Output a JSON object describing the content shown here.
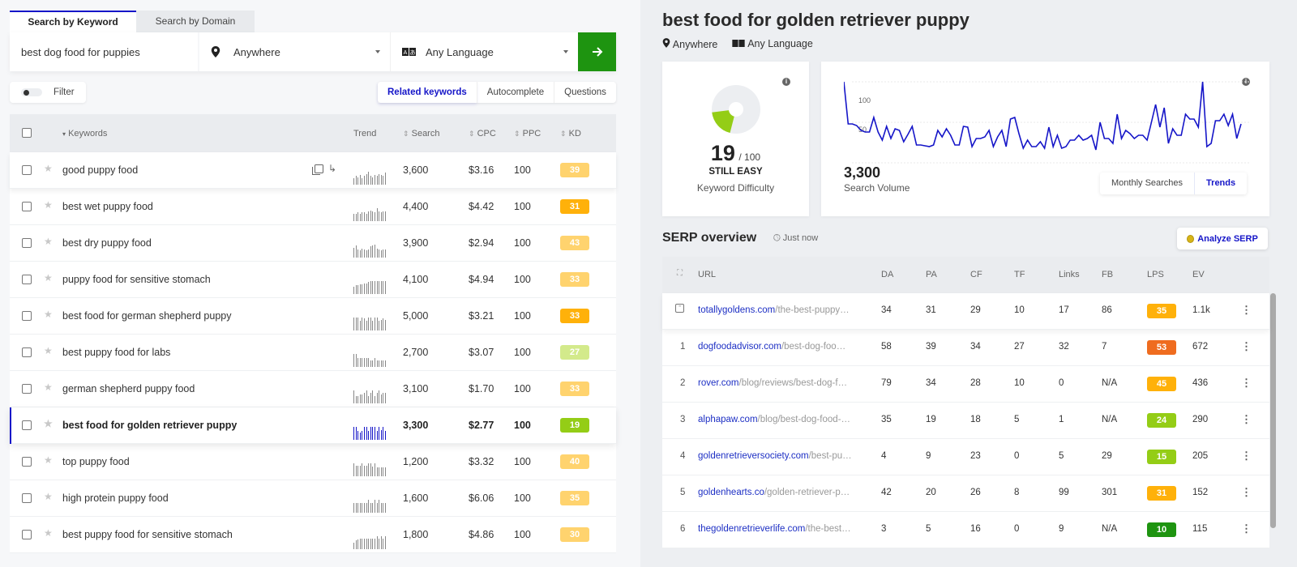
{
  "tabs": [
    {
      "label": "Search by Keyword",
      "active": true
    },
    {
      "label": "Search by Domain",
      "active": false
    }
  ],
  "search": {
    "query": "best dog food for puppies",
    "location": "Anywhere",
    "language": "Any Language",
    "go_icon": "arrow-right-icon"
  },
  "filter": {
    "label": "Filter",
    "enabled": false
  },
  "keyword_modes": [
    {
      "label": "Related keywords",
      "active": true
    },
    {
      "label": "Autocomplete",
      "active": false
    },
    {
      "label": "Questions",
      "active": false
    }
  ],
  "keyword_table": {
    "columns": {
      "keywords": "Keywords",
      "trend": "Trend",
      "search": "Search",
      "cpc": "CPC",
      "ppc": "PPC",
      "kd": "KD"
    },
    "rows": [
      {
        "keyword": "good puppy food",
        "search": "3,600",
        "cpc": "$3.16",
        "ppc": "100",
        "kd": "39",
        "kd_color": "#ffd36e",
        "trend": [
          6,
          8,
          7,
          9,
          6,
          8,
          10,
          12,
          8,
          7,
          9,
          8,
          10,
          9,
          8,
          11
        ],
        "hover": true
      },
      {
        "keyword": "best wet puppy food",
        "search": "4,400",
        "cpc": "$4.42",
        "ppc": "100",
        "kd": "31",
        "kd_color": "#ffb10a",
        "trend": [
          7,
          7,
          8,
          7,
          8,
          8,
          7,
          9,
          10,
          9,
          8,
          12,
          9,
          8,
          9,
          9
        ]
      },
      {
        "keyword": "best dry puppy food",
        "search": "3,900",
        "cpc": "$2.94",
        "ppc": "100",
        "kd": "43",
        "kd_color": "#ffd36e",
        "trend": [
          10,
          12,
          8,
          7,
          9,
          8,
          7,
          8,
          11,
          12,
          13,
          9,
          8,
          7,
          8,
          8
        ]
      },
      {
        "keyword": "puppy food for sensitive stomach",
        "search": "4,100",
        "cpc": "$4.94",
        "ppc": "100",
        "kd": "33",
        "kd_color": "#ffd36e",
        "trend": [
          7,
          8,
          8,
          9,
          9,
          10,
          10,
          11,
          12,
          12,
          12,
          12,
          12,
          12,
          12,
          12
        ]
      },
      {
        "keyword": "best food for german shepherd puppy",
        "search": "5,000",
        "cpc": "$3.21",
        "ppc": "100",
        "kd": "33",
        "kd_color": "#ffb10a",
        "trend": [
          12,
          12,
          12,
          9,
          12,
          11,
          9,
          12,
          12,
          9,
          12,
          12,
          9,
          10,
          11,
          10
        ]
      },
      {
        "keyword": "best puppy food for labs",
        "search": "2,700",
        "cpc": "$3.07",
        "ppc": "100",
        "kd": "27",
        "kd_color": "#d3ea8b",
        "trend": [
          12,
          12,
          8,
          8,
          8,
          8,
          8,
          8,
          6,
          6,
          8,
          6,
          6,
          6,
          6,
          6
        ]
      },
      {
        "keyword": "german shepherd puppy food",
        "search": "3,100",
        "cpc": "$1.70",
        "ppc": "100",
        "kd": "33",
        "kd_color": "#ffd36e",
        "trend": [
          12,
          7,
          7,
          8,
          8,
          10,
          12,
          7,
          10,
          12,
          7,
          10,
          12,
          8,
          10,
          10
        ]
      },
      {
        "keyword": "best food for golden retriever puppy",
        "search": "3,300",
        "cpc": "$2.77",
        "ppc": "100",
        "kd": "19",
        "kd_color": "#94cd16",
        "trend": [
          12,
          12,
          8,
          7,
          8,
          12,
          12,
          8,
          12,
          12,
          12,
          8,
          12,
          9,
          12,
          8
        ],
        "selected": true
      },
      {
        "keyword": "top puppy food",
        "search": "1,200",
        "cpc": "$3.32",
        "ppc": "100",
        "kd": "40",
        "kd_color": "#ffd36e",
        "trend": [
          12,
          10,
          10,
          10,
          12,
          10,
          10,
          12,
          12,
          9,
          12,
          8,
          8,
          8,
          8,
          8
        ]
      },
      {
        "keyword": "high protein puppy food",
        "search": "1,600",
        "cpc": "$6.06",
        "ppc": "100",
        "kd": "35",
        "kd_color": "#ffd36e",
        "trend": [
          9,
          9,
          9,
          9,
          9,
          9,
          9,
          12,
          9,
          9,
          12,
          9,
          12,
          9,
          9,
          9
        ]
      },
      {
        "keyword": "best puppy food for sensitive stomach",
        "search": "1,800",
        "cpc": "$4.86",
        "ppc": "100",
        "kd": "30",
        "kd_color": "#ffd36e",
        "trend": [
          6,
          8,
          9,
          10,
          10,
          10,
          10,
          10,
          10,
          10,
          10,
          12,
          10,
          12,
          10,
          12
        ]
      }
    ]
  },
  "detail": {
    "title": "best food for golden retriever puppy",
    "location": "Anywhere",
    "language": "Any Language",
    "kd_card": {
      "value": "19",
      "max": "/ 100",
      "verdict": "STILL EASY",
      "label": "Keyword Difficulty",
      "fraction": 0.19,
      "color": "#94cd16"
    },
    "sv_card": {
      "value": "3,300",
      "label": "Search Volume",
      "y_ticks": [
        "100",
        "50"
      ],
      "modes": [
        {
          "label": "Monthly Searches",
          "active": false
        },
        {
          "label": "Trends",
          "active": true
        }
      ],
      "line_color": "#1515c8",
      "series": [
        100,
        48,
        48,
        46,
        40,
        38,
        38,
        56,
        38,
        28,
        45,
        30,
        42,
        40,
        26,
        35,
        45,
        22,
        22,
        21,
        20,
        22,
        40,
        32,
        42,
        34,
        22,
        22,
        45,
        44,
        20,
        30,
        30,
        32,
        40,
        20,
        32,
        40,
        20,
        54,
        56,
        36,
        18,
        28,
        20,
        20,
        26,
        18,
        44,
        20,
        34,
        18,
        20,
        28,
        28,
        34,
        28,
        30,
        34,
        16,
        50,
        30,
        30,
        24,
        60,
        30,
        40,
        36,
        30,
        34,
        34,
        28,
        50,
        72,
        44,
        68,
        24,
        42,
        34,
        34,
        60,
        54,
        54,
        44,
        100,
        20,
        24,
        52,
        52,
        60,
        46,
        60,
        30,
        48
      ]
    }
  },
  "serp": {
    "title": "SERP overview",
    "time": "Just now",
    "analyze_label": "Analyze SERP",
    "columns": [
      "URL",
      "DA",
      "PA",
      "CF",
      "TF",
      "Links",
      "FB",
      "LPS",
      "EV"
    ],
    "rows": [
      {
        "rank": "",
        "rank_icon": "quote-snippet-icon",
        "domain": "totallygoldens.com",
        "path": "/the-best-puppy…",
        "da": "34",
        "pa": "31",
        "cf": "29",
        "tf": "10",
        "links": "17",
        "fb": "86",
        "lps": "35",
        "lps_color": "#ffb10a",
        "ev": "1.1k"
      },
      {
        "rank": "1",
        "domain": "dogfoodadvisor.com",
        "path": "/best-dog-foo…",
        "da": "58",
        "pa": "39",
        "cf": "34",
        "tf": "27",
        "links": "32",
        "fb": "7",
        "lps": "53",
        "lps_color": "#ef6c1f",
        "ev": "672"
      },
      {
        "rank": "2",
        "domain": "rover.com",
        "path": "/blog/reviews/best-dog-f…",
        "da": "79",
        "pa": "34",
        "cf": "28",
        "tf": "10",
        "links": "0",
        "fb": "N/A",
        "lps": "45",
        "lps_color": "#ffb10a",
        "ev": "436"
      },
      {
        "rank": "3",
        "domain": "alphapaw.com",
        "path": "/blog/best-dog-food-…",
        "da": "35",
        "pa": "19",
        "cf": "18",
        "tf": "5",
        "links": "1",
        "fb": "N/A",
        "lps": "24",
        "lps_color": "#94cd16",
        "ev": "290"
      },
      {
        "rank": "4",
        "domain": "goldenretrieversociety.com",
        "path": "/best-pu…",
        "da": "4",
        "pa": "9",
        "cf": "23",
        "tf": "0",
        "links": "5",
        "fb": "29",
        "lps": "15",
        "lps_color": "#94cd16",
        "ev": "205"
      },
      {
        "rank": "5",
        "domain": "goldenhearts.co",
        "path": "/golden-retriever-p…",
        "da": "42",
        "pa": "20",
        "cf": "26",
        "tf": "8",
        "links": "99",
        "fb": "301",
        "lps": "31",
        "lps_color": "#ffb10a",
        "ev": "152"
      },
      {
        "rank": "6",
        "domain": "thegoldenretrieverlife.com",
        "path": "/the-best…",
        "da": "3",
        "pa": "5",
        "cf": "16",
        "tf": "0",
        "links": "9",
        "fb": "N/A",
        "lps": "10",
        "lps_color": "#1e9410",
        "ev": "115"
      }
    ]
  }
}
